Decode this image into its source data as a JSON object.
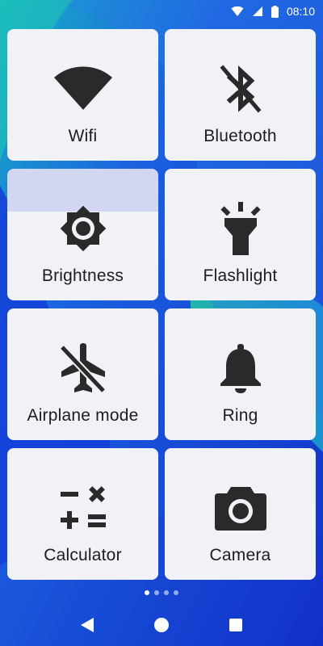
{
  "status_bar": {
    "time": "08:10",
    "icons": [
      "wifi-icon",
      "cell-signal-icon",
      "battery-icon"
    ]
  },
  "tiles": [
    {
      "label": "Wifi",
      "icon": "wifi-icon"
    },
    {
      "label": "Bluetooth",
      "icon": "bluetooth-off-icon"
    },
    {
      "label": "Brightness",
      "icon": "brightness-icon"
    },
    {
      "label": "Flashlight",
      "icon": "flashlight-icon"
    },
    {
      "label": "Airplane mode",
      "icon": "airplane-off-icon"
    },
    {
      "label": "Ring",
      "icon": "bell-icon"
    },
    {
      "label": "Calculator",
      "icon": "calculator-icon"
    },
    {
      "label": "Camera",
      "icon": "camera-icon"
    }
  ],
  "pager": {
    "page_count": 4,
    "current_page": 1
  },
  "nav_bar": {
    "icons": [
      "back-icon",
      "home-icon",
      "recents-icon"
    ]
  },
  "colors": {
    "tile_background": "#f1f1f8",
    "icon_color": "#2a2a2a",
    "wallpaper_blue": "#1a3fd6",
    "wallpaper_teal": "#1fb5a8"
  }
}
